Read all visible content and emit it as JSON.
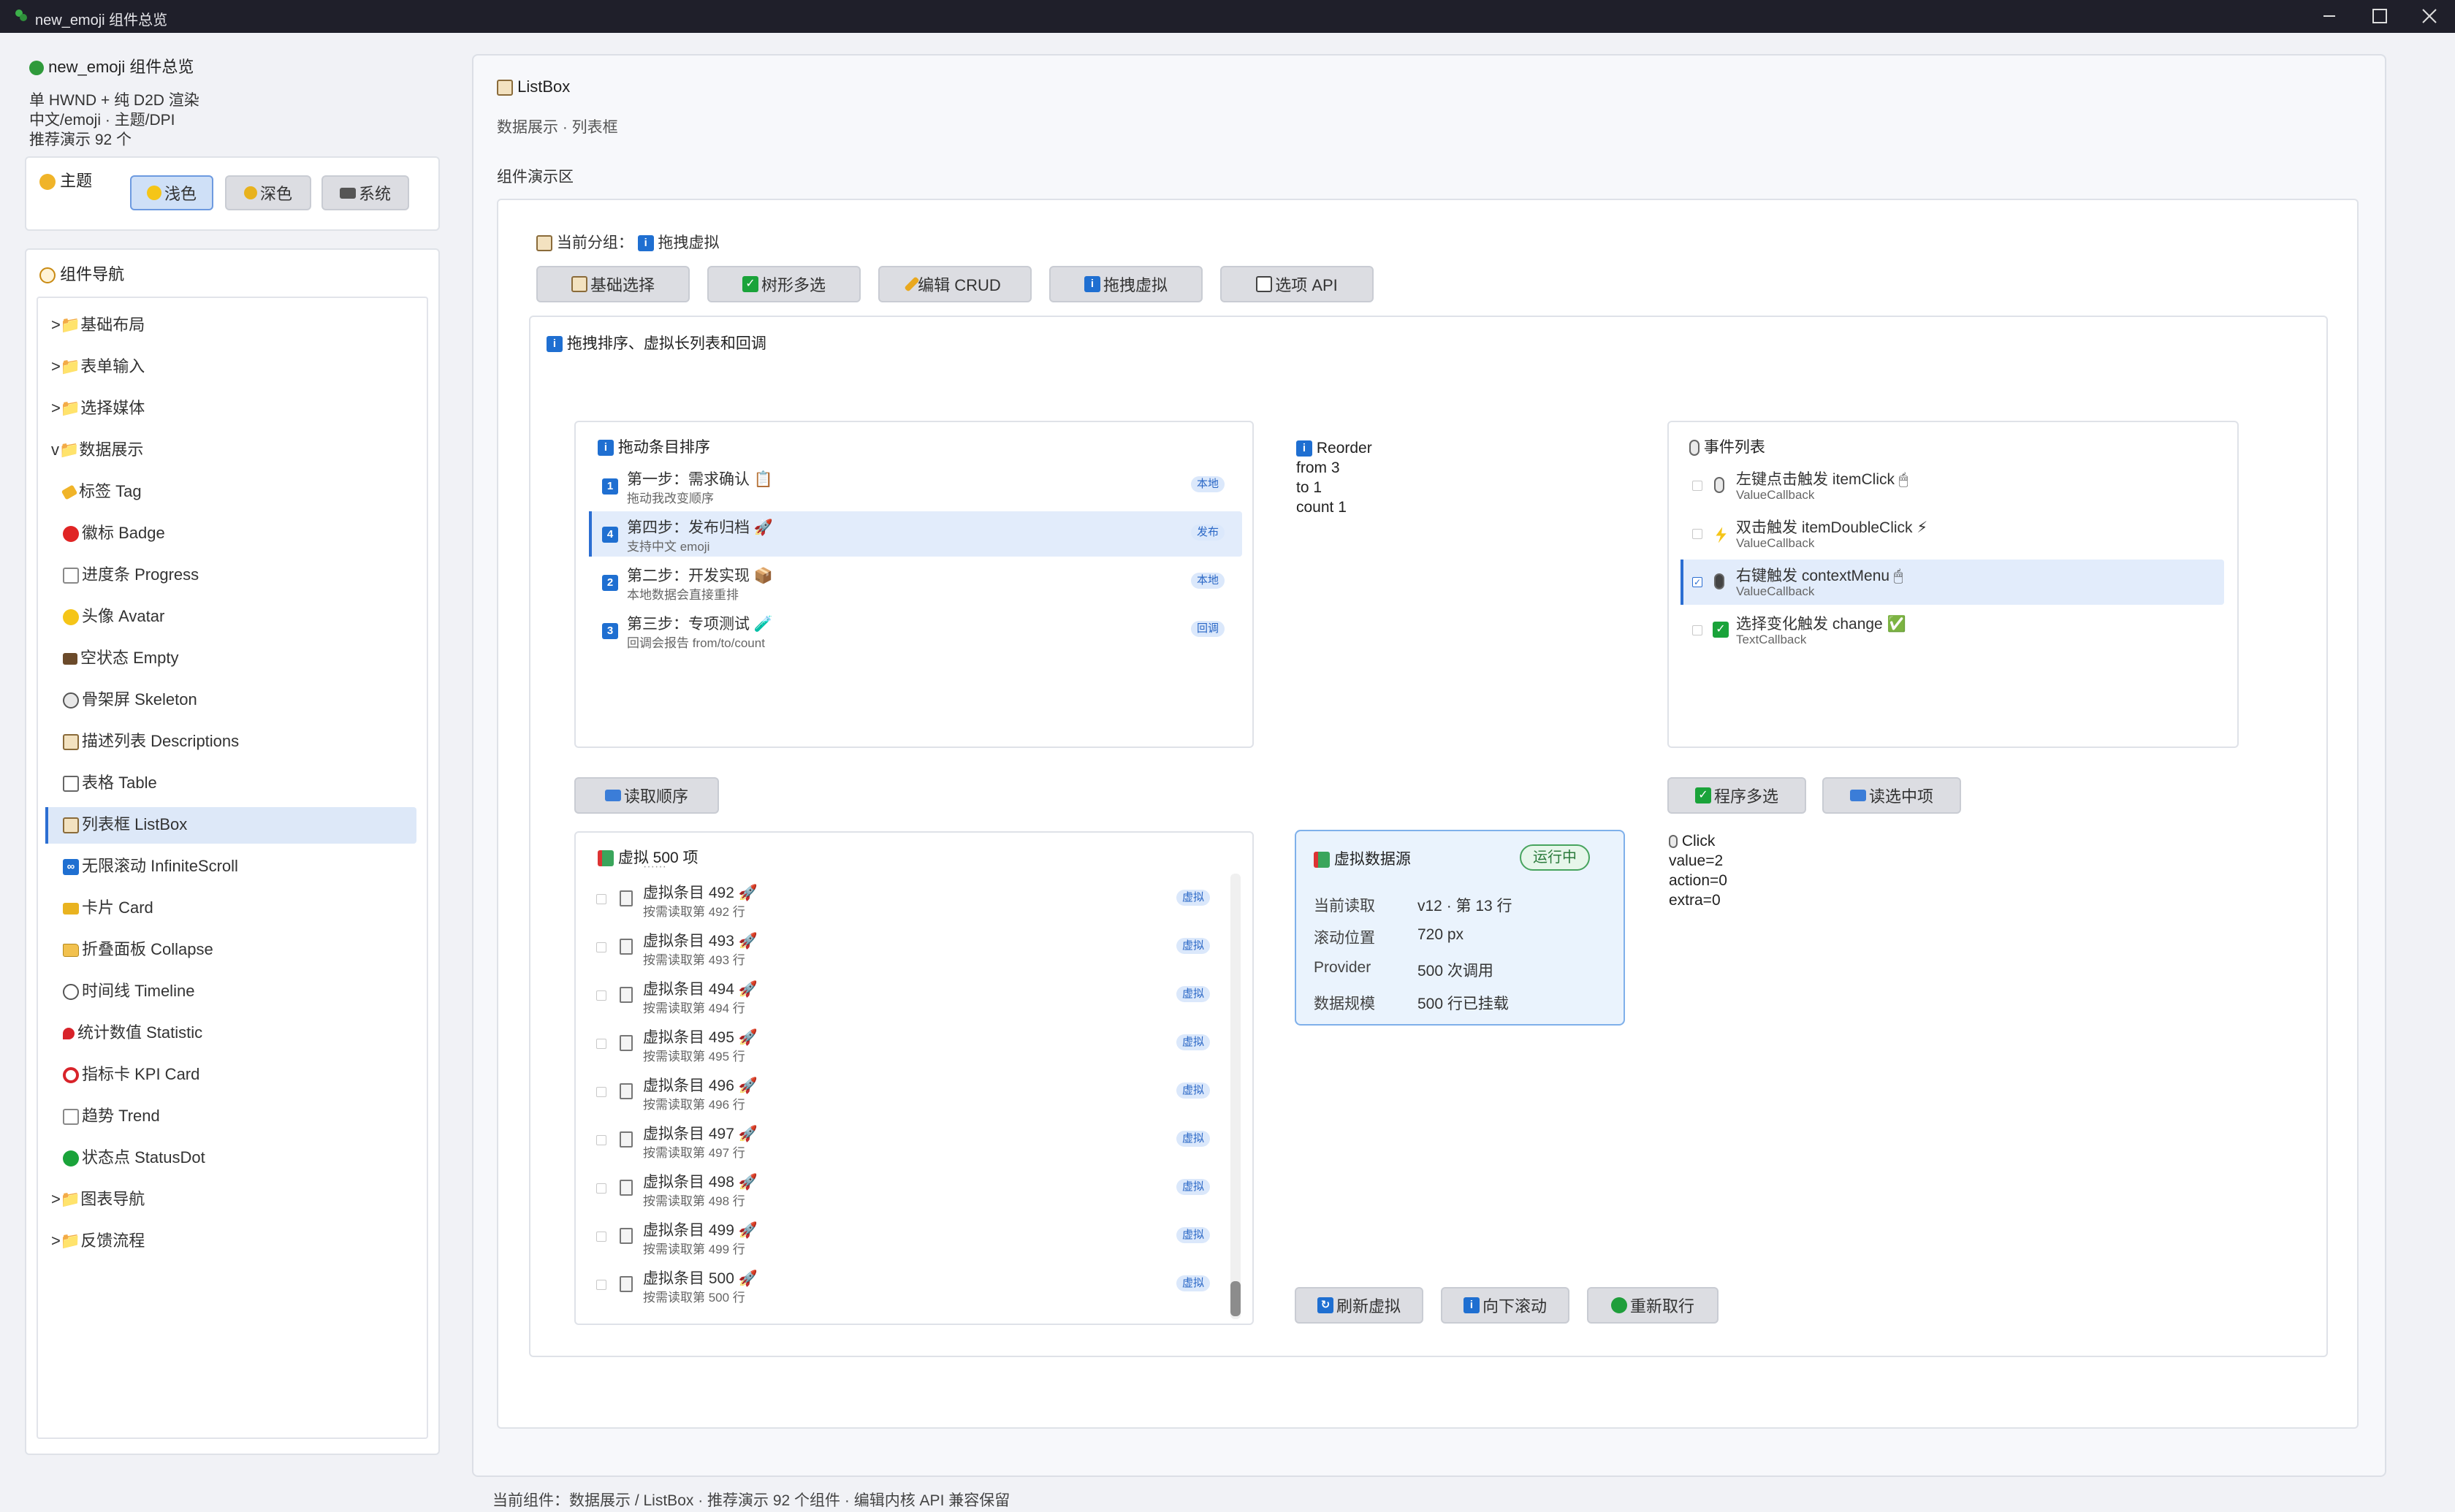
{
  "window": {
    "title": "new_emoji 组件总览"
  },
  "sidebar": {
    "app_title": "new_emoji 组件总览",
    "desc_lines": [
      "单 HWND + 纯 D2D 渲染",
      "中文/emoji · 主题/DPI",
      "推荐演示 92 个"
    ],
    "theme": {
      "label": "主题",
      "buttons": [
        {
          "label": "浅色",
          "icon": "sun-icon",
          "selected": true
        },
        {
          "label": "深色",
          "icon": "moon-icon",
          "selected": false
        },
        {
          "label": "系统",
          "icon": "laptop-icon",
          "selected": false
        }
      ]
    },
    "nav": {
      "title": "组件导航",
      "items": [
        {
          "text": ">📁基础布局",
          "level": 0
        },
        {
          "text": ">📁表单输入",
          "level": 0
        },
        {
          "text": ">📁选择媒体",
          "level": 0
        },
        {
          "text": "v📁数据展示",
          "level": 0
        },
        {
          "text": "标签 Tag",
          "level": 1,
          "icon": "tag-icon"
        },
        {
          "text": "徽标 Badge",
          "level": 1,
          "icon": "red-circle-icon"
        },
        {
          "text": "进度条 Progress",
          "level": 1,
          "icon": "chart-icon"
        },
        {
          "text": "头像 Avatar",
          "level": 1,
          "icon": "smiley-icon"
        },
        {
          "text": "空状态 Empty",
          "level": 1,
          "icon": "mailbox-icon"
        },
        {
          "text": "骨架屏 Skeleton",
          "level": 1,
          "icon": "skull-icon"
        },
        {
          "text": "描述列表 Descriptions",
          "level": 1,
          "icon": "clipboard-icon"
        },
        {
          "text": "表格 Table",
          "level": 1,
          "icon": "bar-chart-icon"
        },
        {
          "text": "列表框 ListBox",
          "level": 1,
          "icon": "clipboard-icon",
          "selected": true
        },
        {
          "text": "无限滚动 InfiniteScroll",
          "level": 1,
          "icon": "infinity-icon"
        },
        {
          "text": "卡片 Card",
          "level": 1,
          "icon": "card-icon"
        },
        {
          "text": "折叠面板 Collapse",
          "level": 1,
          "icon": "folder-icon"
        },
        {
          "text": "时间线 Timeline",
          "level": 1,
          "icon": "clock-icon"
        },
        {
          "text": "统计数值 Statistic",
          "level": 1,
          "icon": "pin-icon"
        },
        {
          "text": "指标卡 KPI Card",
          "level": 1,
          "icon": "target-icon"
        },
        {
          "text": "趋势 Trend",
          "level": 1,
          "icon": "trend-icon"
        },
        {
          "text": "状态点 StatusDot",
          "level": 1,
          "icon": "green-circle-icon"
        },
        {
          "text": ">📁图表导航",
          "level": 0
        },
        {
          "text": ">📁反馈流程",
          "level": 0
        }
      ]
    }
  },
  "main": {
    "title": "ListBox",
    "subtitle": "数据展示 · 列表框",
    "section_label": "组件演示区",
    "group_prefix": "当前分组：",
    "group_name": "拖拽虚拟",
    "tabs": [
      {
        "label": "基础选择",
        "icon": "clipboard-icon"
      },
      {
        "label": "树形多选",
        "icon": "check-icon"
      },
      {
        "label": "编辑 CRUD",
        "icon": "pencil-icon"
      },
      {
        "label": "拖拽虚拟",
        "icon": "info-icon"
      },
      {
        "label": "选项 API",
        "icon": "grid-icon"
      }
    ],
    "demo_title": "拖拽排序、虚拟长列表和回调",
    "drag_list": {
      "title": "拖动条目排序",
      "items": [
        {
          "num": "1",
          "title": "第一步：需求确认 📋",
          "sub": "拖动我改变顺序",
          "tag": "本地",
          "selected": false
        },
        {
          "num": "4",
          "title": "第四步：发布归档 🚀",
          "sub": "支持中文 emoji",
          "tag": "发布",
          "selected": true
        },
        {
          "num": "2",
          "title": "第二步：开发实现 📦",
          "sub": "本地数据会直接重排",
          "tag": "本地",
          "selected": false
        },
        {
          "num": "3",
          "title": "第三步：专项测试 🧪",
          "sub": "回调会报告 from/to/count",
          "tag": "回调",
          "selected": false
        }
      ]
    },
    "reorder_info": {
      "title": "Reorder",
      "lines": [
        "from 3",
        "to 1",
        "count 1"
      ]
    },
    "events": {
      "title": "事件列表",
      "items": [
        {
          "title": "左键点击触发 itemClick 🖱",
          "sub": "ValueCallback",
          "checked": false,
          "selected": false,
          "icon": "mouse-icon"
        },
        {
          "title": "双击触发 itemDoubleClick ⚡",
          "sub": "ValueCallback",
          "checked": false,
          "selected": false,
          "icon": "lightning-icon"
        },
        {
          "title": "右键触发 contextMenu 🖱",
          "sub": "ValueCallback",
          "checked": true,
          "selected": true,
          "icon": "mouse-icon"
        },
        {
          "title": "选择变化触发 change ✅",
          "sub": "TextCallback",
          "checked": false,
          "selected": false,
          "icon": "check-icon"
        }
      ]
    },
    "read_order_button": "读取顺序",
    "multi_select_button": "程序多选",
    "read_selected_button": "读选中项",
    "virtual_list": {
      "title": "虚拟 500 项",
      "items": [
        {
          "title": "虚拟条目 492 🚀",
          "sub": "按需读取第 492 行",
          "tag": "虚拟"
        },
        {
          "title": "虚拟条目 493 🚀",
          "sub": "按需读取第 493 行",
          "tag": "虚拟"
        },
        {
          "title": "虚拟条目 494 🚀",
          "sub": "按需读取第 494 行",
          "tag": "虚拟"
        },
        {
          "title": "虚拟条目 495 🚀",
          "sub": "按需读取第 495 行",
          "tag": "虚拟"
        },
        {
          "title": "虚拟条目 496 🚀",
          "sub": "按需读取第 496 行",
          "tag": "虚拟"
        },
        {
          "title": "虚拟条目 497 🚀",
          "sub": "按需读取第 497 行",
          "tag": "虚拟"
        },
        {
          "title": "虚拟条目 498 🚀",
          "sub": "按需读取第 498 行",
          "tag": "虚拟"
        },
        {
          "title": "虚拟条目 499 🚀",
          "sub": "按需读取第 499 行",
          "tag": "虚拟"
        },
        {
          "title": "虚拟条目 500 🚀",
          "sub": "按需读取第 500 行",
          "tag": "虚拟"
        }
      ]
    },
    "datasource": {
      "title": "虚拟数据源",
      "status": "运行中",
      "rows": [
        {
          "k": "当前读取",
          "v": "v12 · 第 13 行"
        },
        {
          "k": "滚动位置",
          "v": "720 px"
        },
        {
          "k": "Provider",
          "v": "500 次调用"
        },
        {
          "k": "数据规模",
          "v": "500 行已挂载"
        }
      ]
    },
    "click_info": {
      "title": "Click",
      "lines": [
        "value=2",
        "action=0",
        "extra=0"
      ]
    },
    "bottom_buttons": [
      {
        "label": "刷新虚拟",
        "icon": "refresh-icon"
      },
      {
        "label": "向下滚动",
        "icon": "info-icon"
      },
      {
        "label": "重新取行",
        "icon": "recycle-icon"
      }
    ]
  },
  "statusbar": {
    "text": "当前组件：数据展示 / ListBox · 推荐演示 92 个组件 · 编辑内核 API 兼容保留"
  }
}
